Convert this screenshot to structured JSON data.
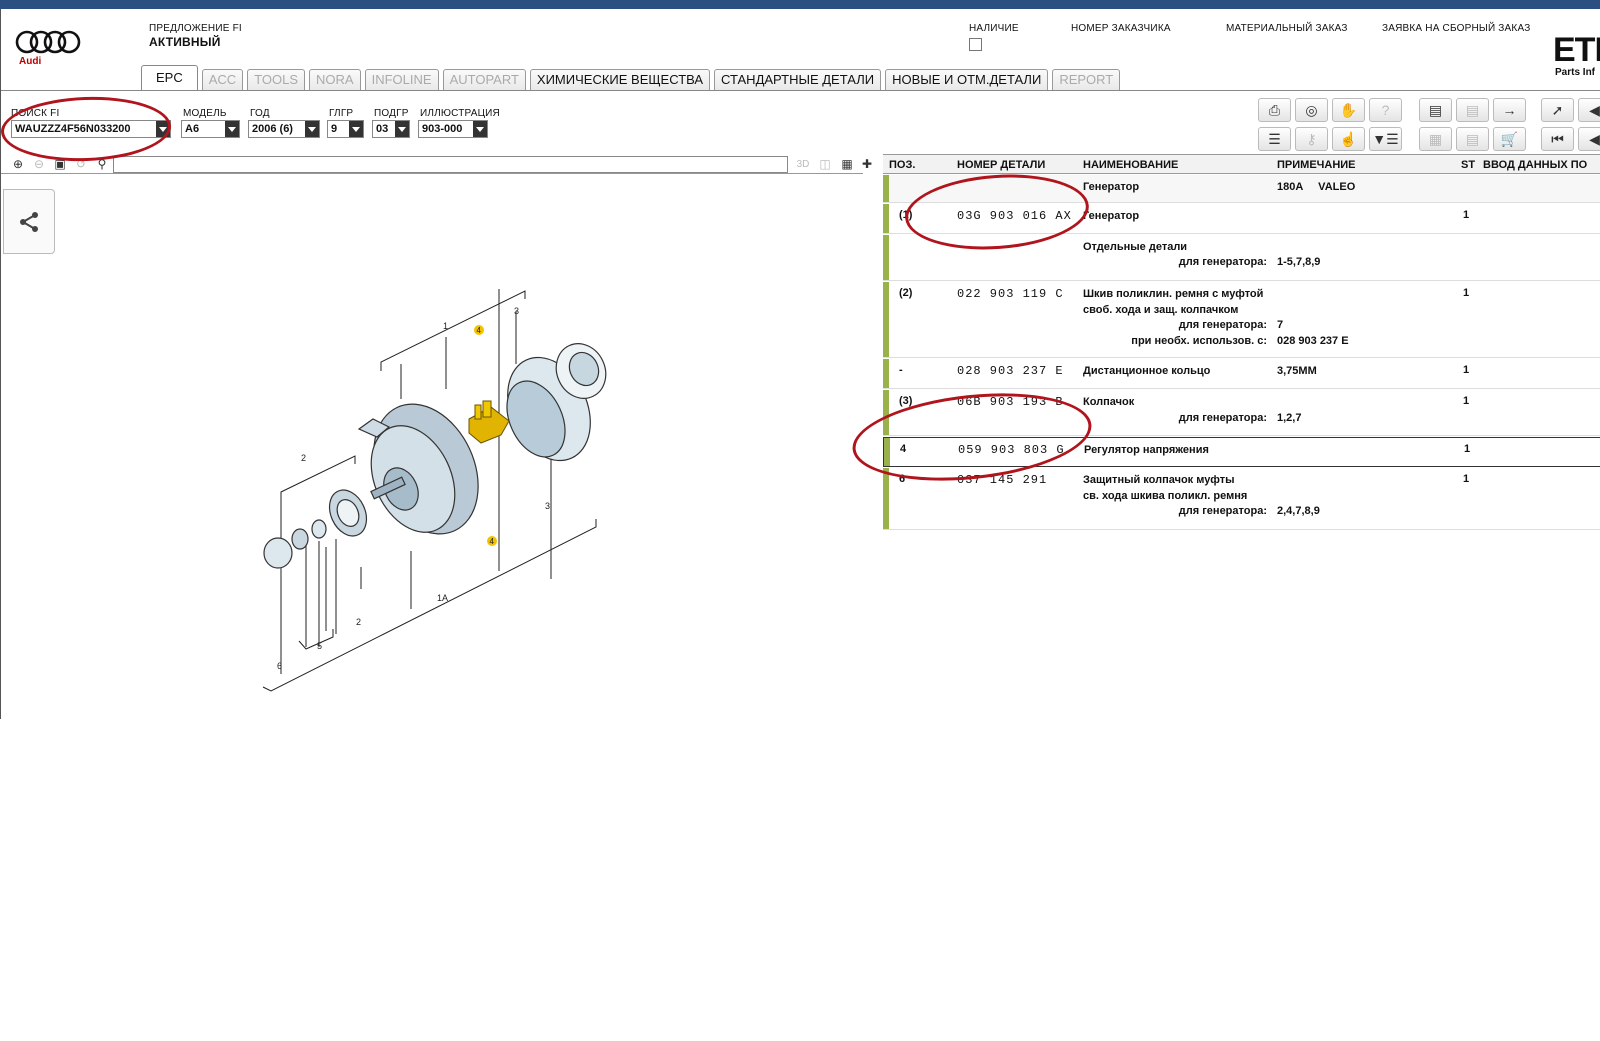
{
  "header": {
    "offer_label": "ПРЕДЛОЖЕНИЕ FI",
    "offer_status": "АКТИВНЫЙ",
    "brand_text": "Audi",
    "availability_label": "НАЛИЧИЕ",
    "customer_number_label": "НОМЕР ЗАКАЗЧИКА",
    "material_order_label": "МАТЕРИАЛЬНЫЙ ЗАКАЗ",
    "assembly_order_label": "ЗАЯВКА НА СБОРНЫЙ ЗАКАЗ",
    "app_logo": "ETI",
    "app_subtitle": "Parts Inf"
  },
  "tabs": [
    {
      "label": "EPC",
      "state": "active"
    },
    {
      "label": "ACC",
      "state": "disabled"
    },
    {
      "label": "TOOLS",
      "state": "disabled"
    },
    {
      "label": "NORA",
      "state": "disabled"
    },
    {
      "label": "INFOLINE",
      "state": "disabled"
    },
    {
      "label": "AUTOPART",
      "state": "disabled"
    },
    {
      "label": "ХИМИЧЕСКИЕ ВЕЩЕСТВА",
      "state": "enabled"
    },
    {
      "label": "СТАНДАРТНЫЕ ДЕТАЛИ",
      "state": "enabled"
    },
    {
      "label": "НОВЫЕ И ОТМ.ДЕТАЛИ",
      "state": "enabled"
    },
    {
      "label": "REPORT",
      "state": "disabled"
    }
  ],
  "selectors": {
    "search_fi": {
      "label": "ПОИСК FI",
      "value": "WAUZZZ4F56N033200"
    },
    "model": {
      "label": "МОДЕЛЬ",
      "value": "A6"
    },
    "year": {
      "label": "ГОД",
      "value": "2006 (6)"
    },
    "main_group": {
      "label": "ГЛГР",
      "value": "9"
    },
    "sub_group": {
      "label": "ПОДГР",
      "value": "03"
    },
    "illustration": {
      "label": "ИЛЛЮСТРАЦИЯ",
      "value": "903-000"
    }
  },
  "graphic_toolbar": {
    "view_3d": "3D"
  },
  "table": {
    "columns": [
      "ПОЗ.",
      "НОМЕР ДЕТАЛИ",
      "НАИМЕНОВАНИЕ",
      "ПРИМЕЧАНИЕ",
      "ST",
      "ВВОД ДАННЫХ ПО"
    ],
    "rows": [
      {
        "pos": "",
        "number": "",
        "name": "Генератор",
        "note": "180A     VALEO",
        "st": ""
      },
      {
        "pos": "(1)",
        "number": "03G 903 016 AX",
        "name": "Генератор",
        "note": "",
        "st": "1"
      },
      {
        "pos": "",
        "number": "",
        "name": "Отдельные детали",
        "sub": "для генератора:",
        "note": "1-5,7,8,9",
        "st": ""
      },
      {
        "pos": "(2)",
        "number": "022 903 119 C",
        "name1": "Шкив поликлин. ремня с муфтой",
        "name2": "своб. хода и защ. колпачком",
        "sub1": "для генератора:",
        "note1": "7",
        "sub2": "при необх. использов. с:",
        "note2": "028 903 237 E",
        "st": "1"
      },
      {
        "pos": "-",
        "number": "028 903 237 E",
        "name": "Дистанционное кольцо",
        "note": "3,75MM",
        "st": "1"
      },
      {
        "pos": "(3)",
        "number": "06B 903 193 B",
        "name": "Колпачок",
        "sub": "для генератора:",
        "note": "1,2,7",
        "st": "1"
      },
      {
        "pos": "4",
        "number": "059 903 803 G",
        "name": "Регулятор напряжения",
        "note": "",
        "st": "1"
      },
      {
        "pos": "6",
        "number": "037 145 291",
        "name1": "Защитный колпачок муфты",
        "name2": "св. хода шкива поликл. ремня",
        "sub": "для генератора:",
        "note": "2,4,7,8,9",
        "st": "1"
      }
    ]
  },
  "drawing": {
    "callouts": [
      "1",
      "2",
      "3",
      "3",
      "4",
      "4",
      "1A",
      "2",
      "5",
      "6"
    ]
  },
  "icons": [
    "printer-icon",
    "cd-icon",
    "handshake-icon",
    "help-icon",
    "elsa-icon",
    "depot-icon",
    "cart-arrow-icon",
    "pin-icon",
    "list-icon",
    "key-icon",
    "hand-icon",
    "dropdown-list-icon",
    "cart-icon",
    "first-page-icon",
    "share-icon"
  ]
}
